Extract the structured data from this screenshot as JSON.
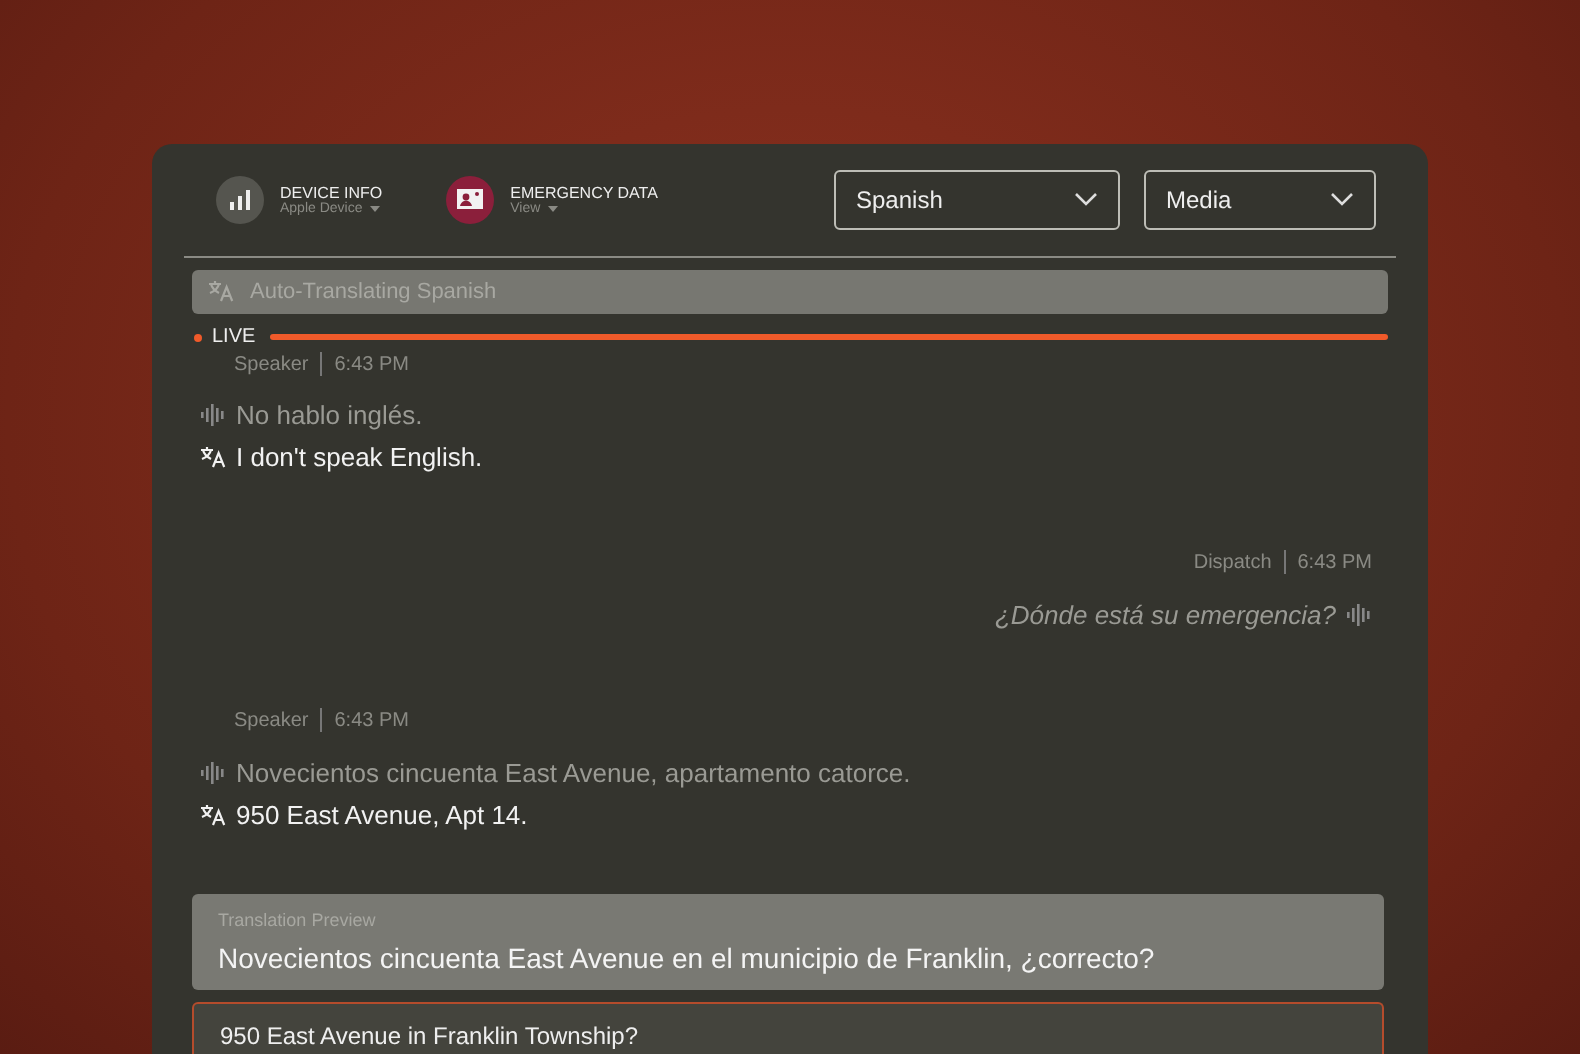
{
  "header": {
    "items": [
      {
        "kind": "signal",
        "label": "DEVICE INFO",
        "sub": "Apple Device"
      },
      {
        "kind": "id-card",
        "label": "EMERGENCY DATA",
        "sub": "View"
      }
    ],
    "dropdowns": [
      {
        "value": "Spanish"
      },
      {
        "value": "Media"
      }
    ]
  },
  "translate_bar": {
    "text": "Auto-Translating Spanish"
  },
  "live": {
    "label": "LIVE"
  },
  "messages": [
    {
      "kind": "incoming",
      "speaker": "Speaker",
      "time": "6:43 PM",
      "original": "No hablo inglés.",
      "translation": "I don't speak English."
    },
    {
      "kind": "outgoing",
      "speaker": "Dispatch",
      "time": "6:43 PM",
      "original": "¿Dónde está su emergencia?"
    },
    {
      "kind": "incoming",
      "speaker": "Speaker",
      "time": "6:43 PM",
      "original": "Novecientos cincuenta East Avenue, apartamento catorce.",
      "translation": "950 East Avenue, Apt 14."
    }
  ],
  "preview": {
    "title": "Translation Preview",
    "text": "Novecientos cincuenta East Avenue en el municipio de Franklin, ¿correcto?"
  },
  "reply": {
    "value": "950 East Avenue in Franklin Township?"
  }
}
